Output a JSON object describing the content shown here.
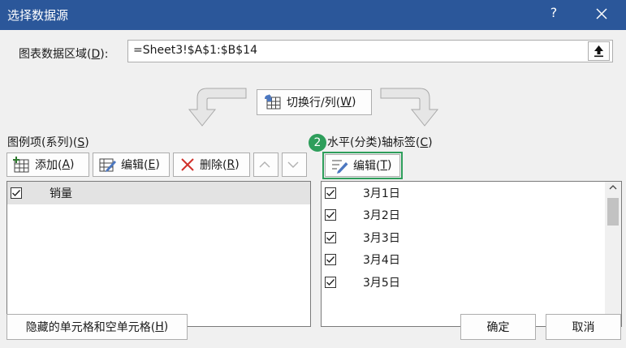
{
  "window": {
    "title": "选择数据源",
    "help": "?"
  },
  "range": {
    "label": "图表数据区域(",
    "label_key": "D",
    "label_end": "):",
    "value": "=Sheet3!$A$1:$B$14"
  },
  "switch_button": {
    "label": "切换行/列(",
    "key": "W",
    "end": ")"
  },
  "legend_section": {
    "label": "图例项(系列)(",
    "key": "S",
    "end": ")",
    "buttons": {
      "add": {
        "label": "添加(",
        "key": "A",
        "end": ")"
      },
      "edit": {
        "label": "编辑(",
        "key": "E",
        "end": ")"
      },
      "delete": {
        "label": "删除(",
        "key": "R",
        "end": ")"
      }
    },
    "items": [
      {
        "label": "销量",
        "checked": true,
        "selected": true
      }
    ]
  },
  "axis_section": {
    "label": "水平(分类)轴标签(",
    "key": "C",
    "end": ")",
    "edit": {
      "label": "编辑(",
      "key": "T",
      "end": ")"
    },
    "badge": "2",
    "items": [
      {
        "label": "3月1日",
        "checked": true
      },
      {
        "label": "3月2日",
        "checked": true
      },
      {
        "label": "3月3日",
        "checked": true
      },
      {
        "label": "3月4日",
        "checked": true
      },
      {
        "label": "3月5日",
        "checked": true
      }
    ]
  },
  "footer": {
    "hidden_cells": {
      "label": "隐藏的单元格和空单元格(",
      "key": "H",
      "end": ")"
    },
    "ok": "确定",
    "cancel": "取消"
  },
  "colors": {
    "titlebar": "#2b579a",
    "highlight": "#2e9e5b"
  }
}
